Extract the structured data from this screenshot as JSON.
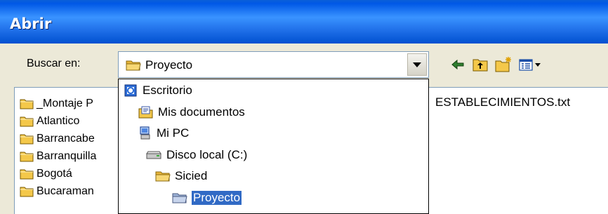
{
  "window": {
    "title": "Abrir"
  },
  "look_in": {
    "label": "Buscar en:",
    "value": "Proyecto"
  },
  "toolbar": {
    "icons": [
      "back-arrow-icon",
      "up-folder-icon",
      "new-folder-icon",
      "view-menu-icon"
    ]
  },
  "files": [
    {
      "name": "_Montaje P",
      "icon": "folder-icon"
    },
    {
      "name": "Atlantico",
      "icon": "folder-icon"
    },
    {
      "name": "Barrancabe",
      "icon": "folder-icon"
    },
    {
      "name": "Barranquilla",
      "icon": "folder-icon"
    },
    {
      "name": "Bogotá",
      "icon": "folder-icon"
    },
    {
      "name": "Bucaraman",
      "icon": "folder-icon"
    }
  ],
  "right_file": {
    "name": "ESTABLECIMIENTOS.txt"
  },
  "dropdown": {
    "items": [
      {
        "label": "Escritorio",
        "icon": "desktop-icon"
      },
      {
        "label": "Mis documentos",
        "icon": "my-documents-icon"
      },
      {
        "label": "Mi PC",
        "icon": "my-computer-icon"
      },
      {
        "label": "Disco local (C:)",
        "icon": "local-disk-icon"
      },
      {
        "label": "Sicied",
        "icon": "folder-open-icon"
      },
      {
        "label": "Proyecto",
        "icon": "folder-open-icon",
        "selected": true
      }
    ]
  },
  "colors": {
    "titlebar": "#0058e6",
    "selection": "#316ac5",
    "folder": "#f4c84a"
  }
}
